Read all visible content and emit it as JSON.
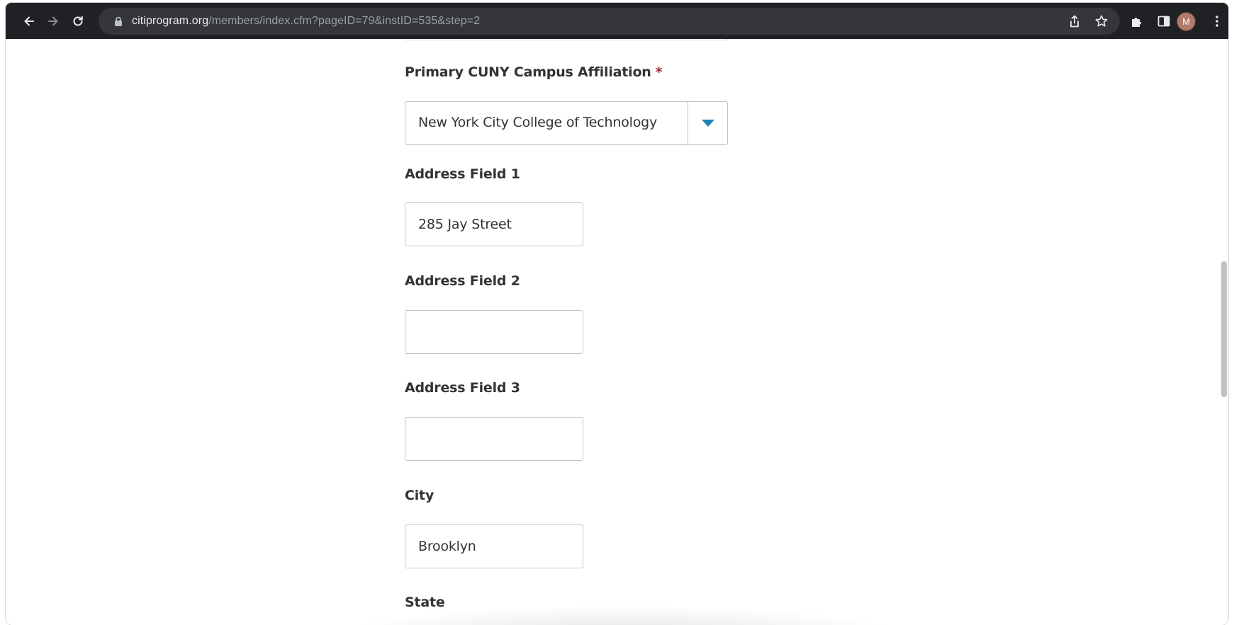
{
  "browser": {
    "url_host": "citiprogram.org",
    "url_path": "/members/index.cfm?pageID=79&instID=535&step=2",
    "profile_initial": "M"
  },
  "form": {
    "campus": {
      "label": "Primary CUNY Campus Affiliation",
      "required_mark": "*",
      "selected_value": "New York City College of Technology"
    },
    "address1": {
      "label": "Address Field 1",
      "value": "285 Jay Street"
    },
    "address2": {
      "label": "Address Field 2",
      "value": ""
    },
    "address3": {
      "label": "Address Field 3",
      "value": ""
    },
    "city": {
      "label": "City",
      "value": "Brooklyn"
    },
    "state": {
      "label": "State"
    }
  },
  "colors": {
    "toolbar_bg": "#202124",
    "omnibox_bg": "#35363a",
    "required": "#a31f34",
    "select_arrow": "#1f7fb5",
    "label_text": "#333333"
  }
}
